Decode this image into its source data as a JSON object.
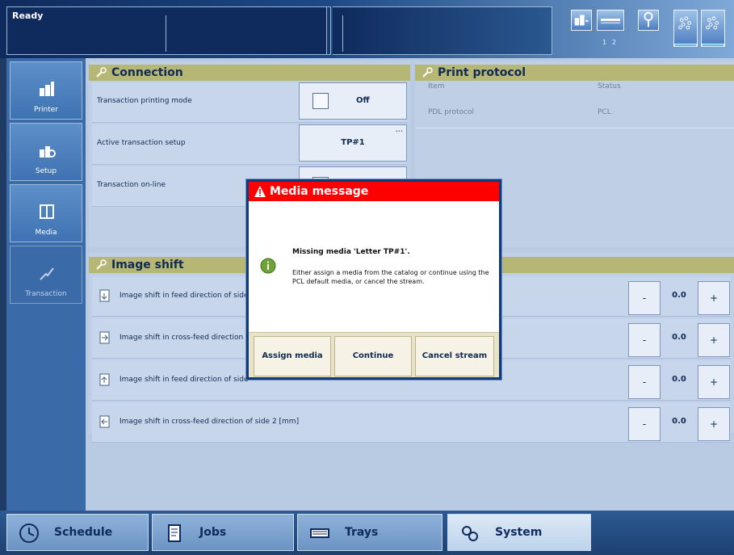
{
  "topbar": {
    "status": "Ready",
    "icons": [
      "printer-flow-icon",
      "key-slot-icon",
      "wrench-icon",
      "toner-dots-icon-1",
      "toner-dots-icon-2"
    ],
    "slot_numbers": [
      "1",
      "2"
    ]
  },
  "leftnav": {
    "items": [
      {
        "label": "Printer",
        "icon": "printer-icon"
      },
      {
        "label": "Setup",
        "icon": "setup-gear-icon"
      },
      {
        "label": "Media",
        "icon": "media-sheets-icon"
      },
      {
        "label": "Transaction",
        "icon": "transaction-icon"
      }
    ]
  },
  "connection": {
    "title": "Connection",
    "rows": [
      {
        "label": "Transaction printing mode",
        "value": "Off"
      },
      {
        "label": "Active transaction setup",
        "value": "TP#1",
        "more": "..."
      },
      {
        "label": "Transaction on-line"
      }
    ]
  },
  "print_protocol": {
    "title": "Print protocol",
    "header_item": "Item",
    "header_status": "Status",
    "rows": [
      {
        "item": "PDL protocol",
        "status": "PCL"
      }
    ]
  },
  "image_shift": {
    "title": "Image shift",
    "rows": [
      {
        "label": "Image shift in feed direction of side",
        "value": "0.0"
      },
      {
        "label": "Image shift in cross-feed direction o",
        "value": "0.0"
      },
      {
        "label": "Image shift in feed direction of side",
        "value": "0.0"
      },
      {
        "label": "Image shift in cross-feed direction of side 2 [mm]",
        "value": "0.0"
      }
    ],
    "minus": "-",
    "plus": "+"
  },
  "bottombar": {
    "tabs": [
      {
        "label": "Schedule",
        "icon": "clock-icon"
      },
      {
        "label": "Jobs",
        "icon": "document-icon"
      },
      {
        "label": "Trays",
        "icon": "paper-tray-icon"
      },
      {
        "label": "System",
        "icon": "system-gears-icon"
      }
    ]
  },
  "modal": {
    "title": "Media message",
    "heading": "Missing media 'Letter TP#1'.",
    "description": "Either assign a media from the catalog or continue using the PCL default media, or cancel the stream.",
    "buttons": {
      "assign": "Assign media",
      "continue": "Continue",
      "cancel": "Cancel stream"
    }
  },
  "colors": {
    "header_red": "#ff0000",
    "section_olive": "#b6b675",
    "nav_blue": "#3a6aa7",
    "modal_footer": "#e9e3c9"
  }
}
